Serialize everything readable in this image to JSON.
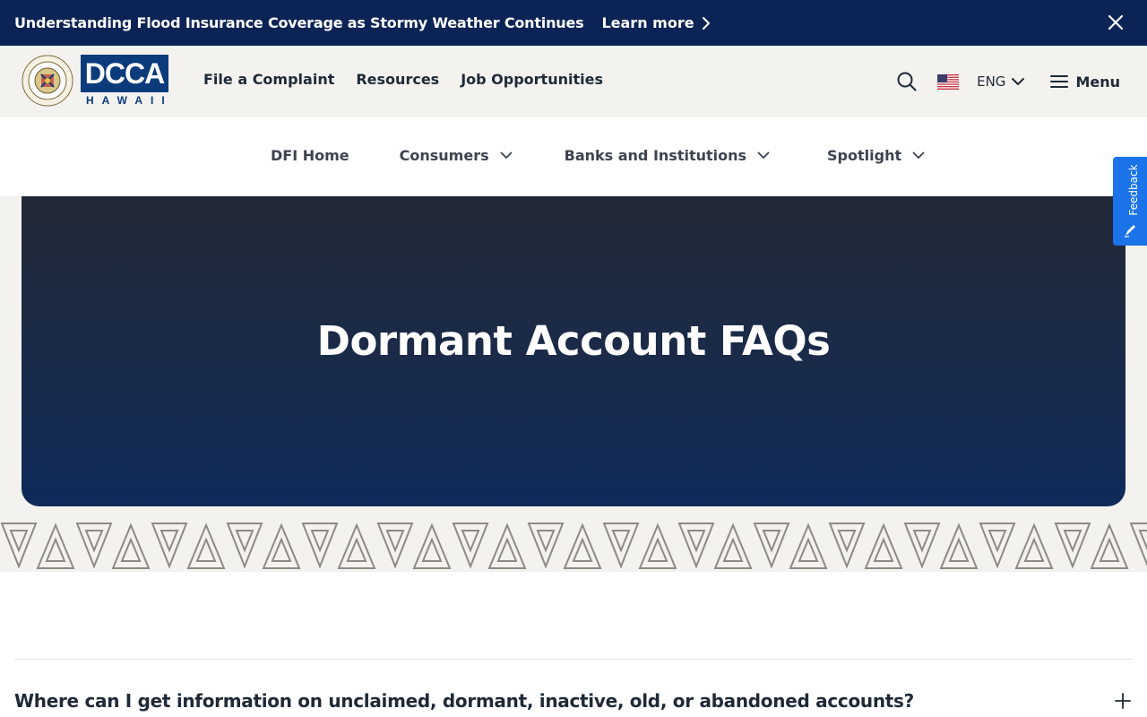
{
  "alert": {
    "message": "Understanding Flood Insurance Coverage as Stormy Weather Continues",
    "link_label": "Learn more",
    "icons": {
      "link": "chevron-right-icon",
      "close": "close-icon"
    }
  },
  "header": {
    "logo_text": "DCCA",
    "logo_subtext": "HAWAII",
    "nav": [
      "File a Complaint",
      "Resources",
      "Job Opportunities"
    ],
    "language": "ENG",
    "menu_label": "Menu",
    "icons": {
      "search": "search-icon",
      "flag": "us-flag-icon",
      "lang": "chevron-down-icon",
      "menu": "hamburger-icon"
    }
  },
  "subnav": {
    "items": [
      {
        "label": "DFI Home",
        "has_dropdown": false
      },
      {
        "label": "Consumers",
        "has_dropdown": true
      },
      {
        "label": "Banks and Institutions",
        "has_dropdown": true
      },
      {
        "label": "Spotlight",
        "has_dropdown": true
      }
    ]
  },
  "hero": {
    "title": "Dormant Account FAQs"
  },
  "feedback": {
    "label": "Feedback"
  },
  "faq": {
    "items": [
      {
        "question": "Where can I get information on unclaimed, dormant, inactive, old, or abandoned accounts?",
        "expanded": false
      }
    ]
  },
  "colors": {
    "banner": "#0b2455",
    "header_bg": "#f3f2ef",
    "hero_top": "#222936",
    "hero_bottom": "#0f2a5a",
    "logo_blue": "#0b3b7a",
    "feedback_blue": "#1a73e8"
  }
}
